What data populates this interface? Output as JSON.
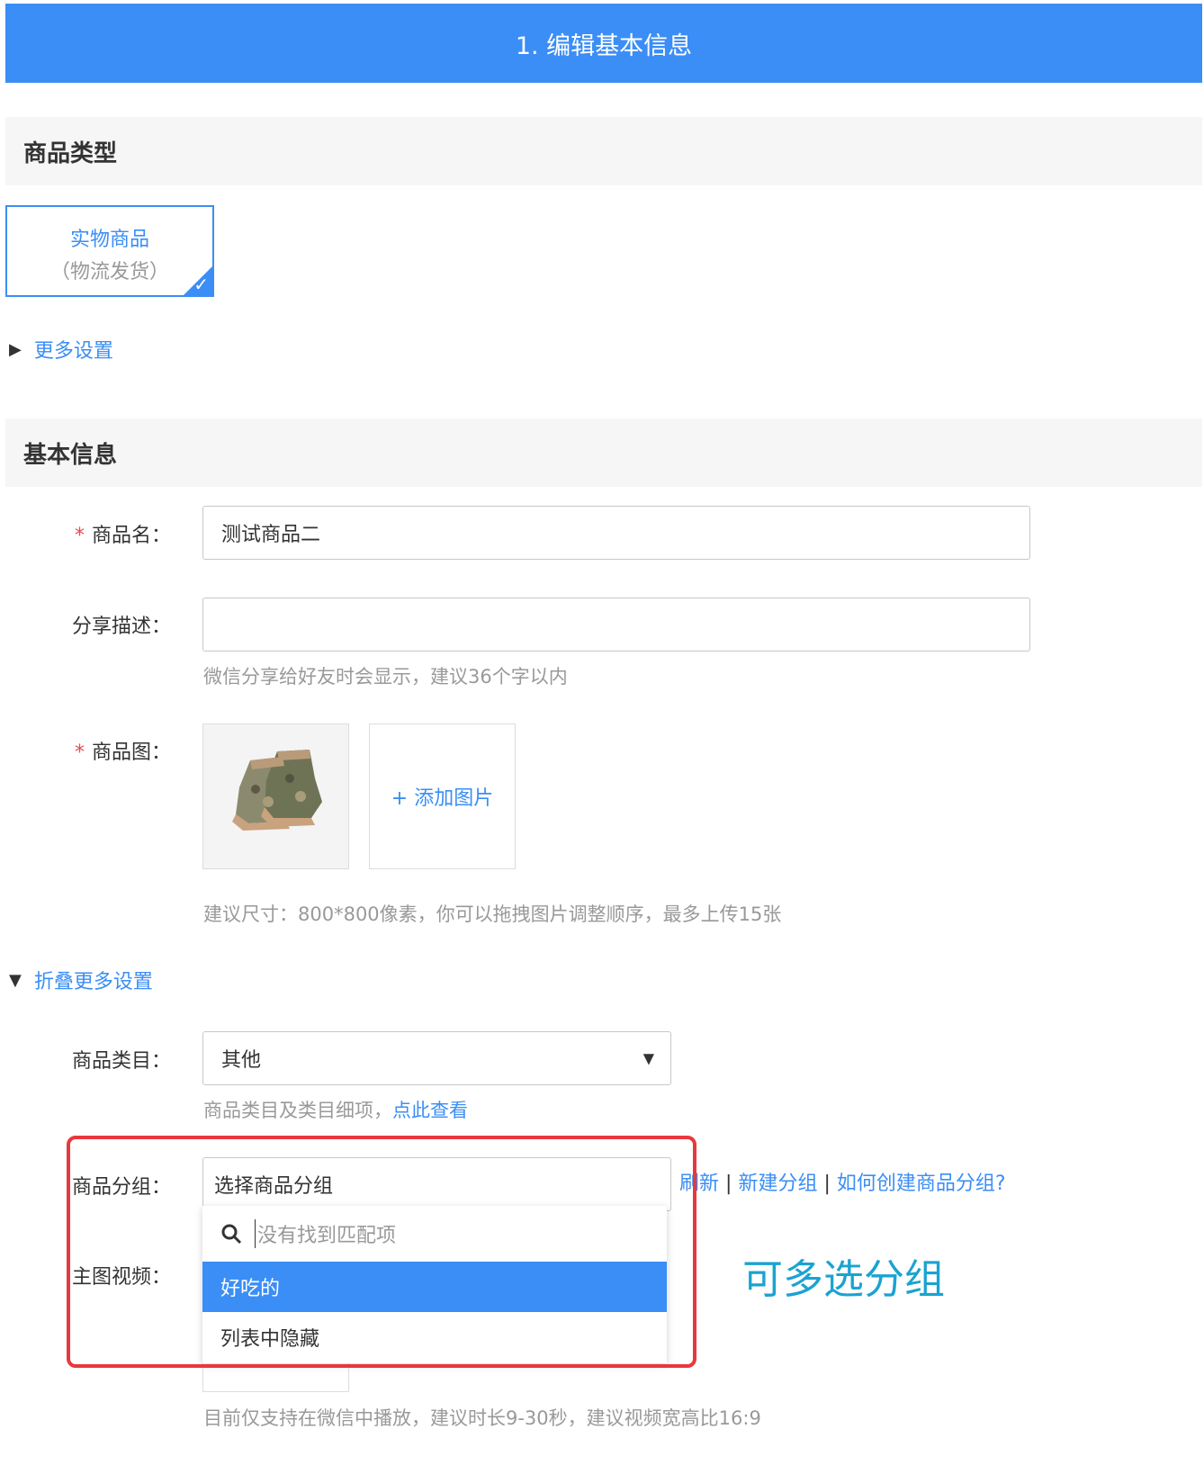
{
  "header": {
    "title": "1. 编辑基本信息"
  },
  "product_type": {
    "section_title": "商品类型",
    "card_title": "实物商品",
    "card_subtitle": "（物流发货）",
    "more_settings": "更多设置"
  },
  "basic_info": {
    "section_title": "基本信息",
    "name_label": "商品名：",
    "name_value": "测试商品二",
    "share_label": "分享描述：",
    "share_value": "",
    "share_hint": "微信分享给好友时会显示，建议36个字以内",
    "image_label": "商品图：",
    "add_image": "+ 添加图片",
    "image_hint": "建议尺寸：800*800像素，你可以拖拽图片调整顺序，最多上传15张",
    "collapse_settings": "折叠更多设置",
    "category_label": "商品类目：",
    "category_value": "其他",
    "category_hint": "商品类目及类目细项，",
    "category_hint_link": "点此查看",
    "group_label": "商品分组：",
    "group_placeholder": "选择商品分组",
    "group_links": {
      "refresh": "刷新",
      "new_group": "新建分组",
      "how_to": "如何创建商品分组?"
    },
    "group_separator": "|",
    "video_label": "主图视频：",
    "video_hint": "目前仅支持在微信中播放，建议时长9-30秒，建议视频宽高比16:9"
  },
  "dropdown": {
    "search_text": "没有找到匹配项",
    "options": [
      "好吃的",
      "列表中隐藏"
    ]
  },
  "annotation": {
    "text": "可多选分组"
  },
  "colors": {
    "brand": "#3b8ef5",
    "required": "#e84a4a",
    "highlight": "#e8383d",
    "annotation": "#1aa3d0"
  }
}
